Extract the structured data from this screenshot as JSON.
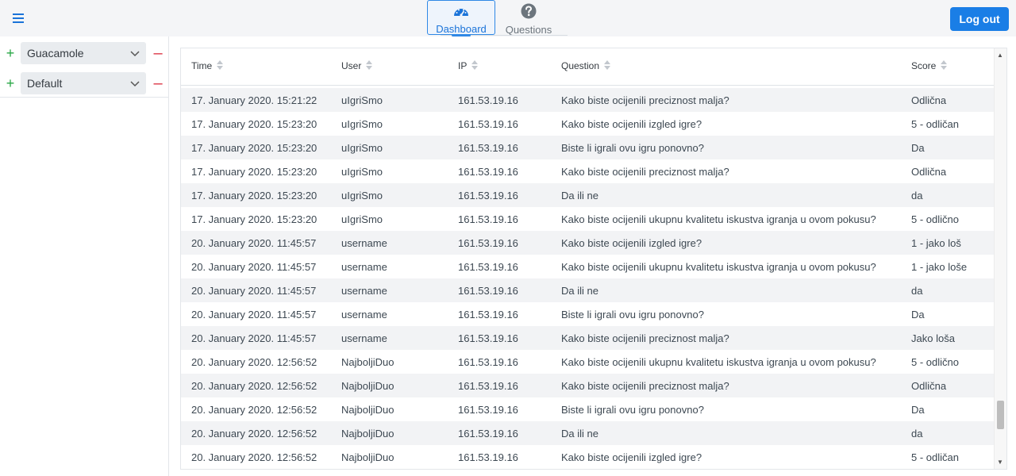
{
  "nav": {
    "tabs": [
      {
        "label": "Dashboard",
        "icon": "speedometer-icon",
        "active": true
      },
      {
        "label": "Questions",
        "icon": "question-circle-icon",
        "active": false
      }
    ]
  },
  "header": {
    "logout_label": "Log out"
  },
  "sidebar": {
    "games": [
      {
        "name": "Guacamole"
      },
      {
        "name": "Default"
      }
    ]
  },
  "table": {
    "columns": [
      "Time",
      "User",
      "IP",
      "Question",
      "Score"
    ],
    "rows": [
      [
        "17. January 2020. 15:21:22",
        "uIgriSmo",
        "161.53.19.16",
        "Kako biste ocijenili preciznost malja?",
        "Odlična"
      ],
      [
        "17. January 2020. 15:23:20",
        "uIgriSmo",
        "161.53.19.16",
        "Kako biste ocijenili izgled igre?",
        "5 - odličan"
      ],
      [
        "17. January 2020. 15:23:20",
        "uIgriSmo",
        "161.53.19.16",
        "Biste li igrali ovu igru ponovno?",
        "Da"
      ],
      [
        "17. January 2020. 15:23:20",
        "uIgriSmo",
        "161.53.19.16",
        "Kako biste ocijenili preciznost malja?",
        "Odlična"
      ],
      [
        "17. January 2020. 15:23:20",
        "uIgriSmo",
        "161.53.19.16",
        "Da ili ne",
        "da"
      ],
      [
        "17. January 2020. 15:23:20",
        "uIgriSmo",
        "161.53.19.16",
        "Kako biste ocijenili ukupnu kvalitetu iskustva igranja u ovom pokusu?",
        "5 - odlično"
      ],
      [
        "20. January 2020. 11:45:57",
        "username",
        "161.53.19.16",
        "Kako biste ocijenili izgled igre?",
        "1 - jako loš"
      ],
      [
        "20. January 2020. 11:45:57",
        "username",
        "161.53.19.16",
        "Kako biste ocijenili ukupnu kvalitetu iskustva igranja u ovom pokusu?",
        "1 - jako loše"
      ],
      [
        "20. January 2020. 11:45:57",
        "username",
        "161.53.19.16",
        "Da ili ne",
        "da"
      ],
      [
        "20. January 2020. 11:45:57",
        "username",
        "161.53.19.16",
        "Biste li igrali ovu igru ponovno?",
        "Da"
      ],
      [
        "20. January 2020. 11:45:57",
        "username",
        "161.53.19.16",
        "Kako biste ocijenili preciznost malja?",
        "Jako loša"
      ],
      [
        "20. January 2020. 12:56:52",
        "NajboljiDuo",
        "161.53.19.16",
        "Kako biste ocijenili ukupnu kvalitetu iskustva igranja u ovom pokusu?",
        "5 - odlično"
      ],
      [
        "20. January 2020. 12:56:52",
        "NajboljiDuo",
        "161.53.19.16",
        "Kako biste ocijenili preciznost malja?",
        "Odlična"
      ],
      [
        "20. January 2020. 12:56:52",
        "NajboljiDuo",
        "161.53.19.16",
        "Biste li igrali ovu igru ponovno?",
        "Da"
      ],
      [
        "20. January 2020. 12:56:52",
        "NajboljiDuo",
        "161.53.19.16",
        "Da ili ne",
        "da"
      ],
      [
        "20. January 2020. 12:56:52",
        "NajboljiDuo",
        "161.53.19.16",
        "Kako biste ocijenili izgled igre?",
        "5 - odličan"
      ]
    ]
  },
  "colors": {
    "accent": "#1a7ee6",
    "add": "#28a745",
    "remove": "#dc3545",
    "row_stripe": "#f2f3f5"
  }
}
